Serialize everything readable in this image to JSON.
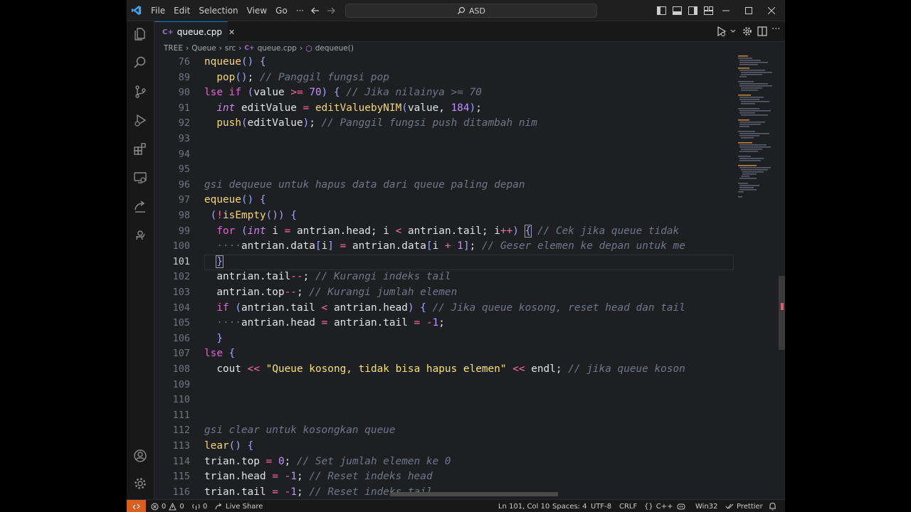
{
  "titlebar": {
    "menus": [
      "File",
      "Edit",
      "Selection",
      "View",
      "Go",
      "···"
    ],
    "search_text": "ASD"
  },
  "tab": {
    "label": "queue.cpp",
    "close": "✕"
  },
  "breadcrumb": {
    "parts": [
      "TREE",
      "Queue",
      "src",
      "queue.cpp",
      "dequeue()"
    ],
    "sep": "›"
  },
  "editor": {
    "lines": [
      {
        "num": "76",
        "html": "<span class=\"f\">nqueue</span><span class=\"p\">()</span> <span class=\"p\">{</span>"
      },
      {
        "num": "89",
        "html": "  <span class=\"f\">pop</span><span class=\"p\">()</span>; <span class=\"c\">// Panggil fungsi pop</span>"
      },
      {
        "num": "90",
        "html": "<span class=\"k\">lse if</span> <span class=\"p\">(</span>value <span class=\"o\">&gt;=</span> <span class=\"n\">70</span><span class=\"p\">)</span> <span class=\"p\">{</span> <span class=\"c\">// Jika nilainya &gt;= 70</span>"
      },
      {
        "num": "91",
        "html": "  <span class=\"t\">int</span> editValue <span class=\"o\">=</span> <span class=\"f\">editValuebyNIM</span><span class=\"p\">(</span>value, <span class=\"n\">184</span><span class=\"p\">)</span>;"
      },
      {
        "num": "92",
        "html": "  <span class=\"f\">push</span><span class=\"p\">(</span>editValue<span class=\"p\">)</span>; <span class=\"c\">// Panggil fungsi push ditambah nim</span>"
      },
      {
        "num": "93",
        "html": ""
      },
      {
        "num": "94",
        "html": ""
      },
      {
        "num": "95",
        "html": ""
      },
      {
        "num": "96",
        "html": "<span class=\"c\">gsi dequeue untuk hapus data dari queue paling depan</span>"
      },
      {
        "num": "97",
        "html": "<span class=\"f\">equeue</span><span class=\"p\">()</span> <span class=\"p\">{</span>"
      },
      {
        "num": "98",
        "html": " <span class=\"p\">(</span><span class=\"o\">!</span><span class=\"f\">isEmpty</span><span class=\"p\">())</span> <span class=\"p\">{</span>"
      },
      {
        "num": "99",
        "html": "  <span class=\"k\">for</span> <span class=\"p\">(</span><span class=\"t\">int</span> i <span class=\"o\">=</span> antrian.head; i <span class=\"o\">&lt;</span> antrian.tail; i<span class=\"o\">++</span><span class=\"p\">)</span> <span class=\"p sel\">{</span> <span class=\"c\">// Cek jika queue tidak</span>"
      },
      {
        "num": "100",
        "html": "  <span class=\"g\">····</span>antrian.data<span class=\"p\">[</span>i<span class=\"p\">]</span> <span class=\"o\">=</span> antrian.data<span class=\"p\">[</span>i <span class=\"o\">+</span> <span class=\"n\">1</span><span class=\"p\">]</span>; <span class=\"c\">// Geser elemen ke depan untuk me</span>"
      },
      {
        "num": "101",
        "html": "  <span class=\"p sel\">}</span>",
        "current": true
      },
      {
        "num": "102",
        "html": "  antrian.tail<span class=\"o\">--</span>; <span class=\"c\">// Kurangi indeks tail</span>"
      },
      {
        "num": "103",
        "html": "  antrian.top<span class=\"o\">--</span>; <span class=\"c\">// Kurangi jumlah elemen</span>"
      },
      {
        "num": "104",
        "html": "  <span class=\"k\">if</span> <span class=\"p\">(</span>antrian.tail <span class=\"o\">&lt;</span> antrian.head<span class=\"p\">)</span> <span class=\"p\">{</span> <span class=\"c\">// Jika queue kosong, reset head dan tail</span>"
      },
      {
        "num": "105",
        "html": "  <span class=\"g\">····</span>antrian.head <span class=\"o\">=</span> antrian.tail <span class=\"o\">=</span> <span class=\"o\">-</span><span class=\"n\">1</span>;"
      },
      {
        "num": "106",
        "html": "  <span class=\"p\">}</span>"
      },
      {
        "num": "107",
        "html": "<span class=\"k\">lse</span> <span class=\"p\">{</span>"
      },
      {
        "num": "108",
        "html": "  cout <span class=\"o\">&lt;&lt;</span> <span class=\"s\">\"Queue kosong, tidak bisa hapus elemen\"</span> <span class=\"o\">&lt;&lt;</span> endl; <span class=\"c\">// jika queue koson</span>"
      },
      {
        "num": "109",
        "html": ""
      },
      {
        "num": "110",
        "html": ""
      },
      {
        "num": "111",
        "html": ""
      },
      {
        "num": "112",
        "html": "<span class=\"c\">gsi clear untuk kosongkan queue</span>"
      },
      {
        "num": "113",
        "html": "<span class=\"f\">lear</span><span class=\"p\">()</span> <span class=\"p\">{</span>"
      },
      {
        "num": "114",
        "html": "trian.top <span class=\"o\">=</span> <span class=\"n\">0</span>; <span class=\"c\">// Set jumlah elemen ke 0</span>"
      },
      {
        "num": "115",
        "html": "trian.head <span class=\"o\">=</span> <span class=\"o\">-</span><span class=\"n\">1</span>; <span class=\"c\">// Reset indeks head</span>"
      },
      {
        "num": "116",
        "html": "trian.tail <span class=\"o\">=</span> <span class=\"o\">-</span><span class=\"n\">1</span>; <span class=\"c\">// Reset indeks tail</span>"
      }
    ]
  },
  "statusbar": {
    "errors": "0",
    "warnings": "0",
    "ports": "0",
    "live_share": "Live Share",
    "position": "Ln 101, Col 10",
    "spaces": "Spaces: 4",
    "encoding": "UTF-8",
    "eol": "CRLF",
    "language": "C++",
    "platform": "Win32",
    "prettier": "Prettier"
  },
  "colors": {
    "accent": "#0078d4",
    "remote": "#d75f21",
    "background": "#1e1f22"
  }
}
